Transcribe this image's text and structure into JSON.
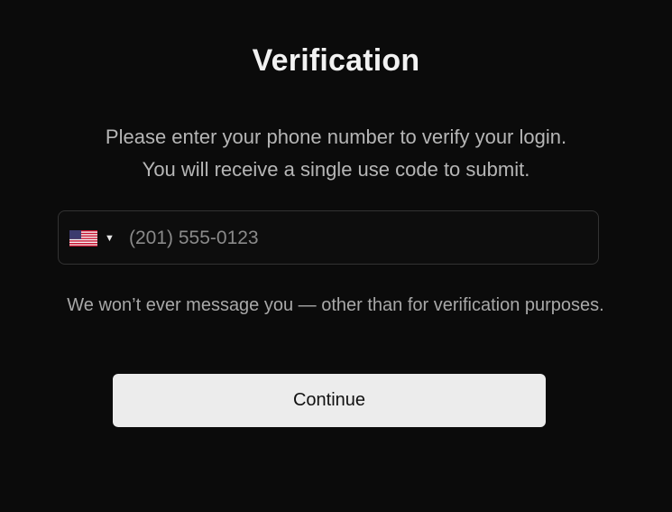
{
  "title": "Verification",
  "description": {
    "line1": "Please enter your phone number to verify your login.",
    "line2": "You will receive a single use code to submit."
  },
  "phone": {
    "country_icon": "us-flag-icon",
    "caret_glyph": "▼",
    "placeholder": "(201) 555-0123",
    "value": ""
  },
  "note": "We won’t ever message you — other than for verification purposes.",
  "continue_label": "Continue",
  "colors": {
    "background": "#0b0b0b",
    "button_bg": "#ececec",
    "field_border": "#333333"
  }
}
